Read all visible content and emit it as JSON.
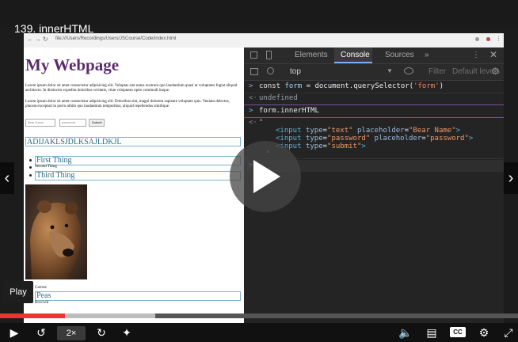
{
  "video": {
    "title": "139. innerHTML",
    "speed": "2×",
    "tooltip": "Play",
    "progress_fraction": 0.125,
    "buffered_fraction": 0.3
  },
  "browser": {
    "url": "file:///Users/Recordings/Users/JSCourse/Code/index.html"
  },
  "webpage": {
    "heading": "My Webpage",
    "paragraph1": "Lorem ipsum dolor sit amet consectetur adipisicing elit. Voluptas sint natus nostrum quo laudantium quasi ut voluptates fugiat aliquid architecto. In distinctio expedita doloribus veritatis, vitae voluptates optio commodi itaque.",
    "paragraph2": "Lorem ipsum dolor sit amet consectetur adipisicing elit. Doloribus sint, magni dolorem sapiente voluptate quis. Veniam delectus, placeat excepturi in porro nihilo quo laudantium temporibus, aliquid repellendus similique.",
    "form": {
      "name_placeholder": "Bear Name",
      "password_placeholder": "password",
      "submit_label": "Submit"
    },
    "boxed_heading": "ADIJAKLSJDLKSAJLDKJL",
    "list_items": [
      "First Thing",
      "Second Thing",
      "Third Thing"
    ],
    "list2_items": [
      "Carrots",
      "Peas",
      "Broccoli"
    ]
  },
  "devtools": {
    "tabs": [
      "Elements",
      "Console",
      "Sources",
      "»"
    ],
    "active_tab": "Console",
    "context": "top",
    "filter_placeholder": "Filter",
    "levels": "Default levels",
    "console": {
      "line1_prompt": ">",
      "line1_a": "const ",
      "line1_b": "form",
      "line1_c": " = document.querySelector(",
      "line1_d": "'form'",
      "line1_e": ")",
      "line2_prompt": "<·",
      "line2_text": "undefined",
      "line3_prompt": ">",
      "line3_text": "form.innerHTML",
      "line4_prompt": "<·",
      "line4_quote": "\"",
      "html_lines": [
        {
          "tag_open": "<input ",
          "a1": "type",
          "v1": "\"text\"",
          "a2": " placeholder",
          "v2": "\"Bear Name\"",
          "close": ">"
        },
        {
          "tag_open": "<input ",
          "a1": "type",
          "v1": "\"password\"",
          "a2": " placeholder",
          "v2": "\"password\"",
          "close": ">"
        },
        {
          "tag_open": "<input ",
          "a1": "type",
          "v1": "\"submit\"",
          "a2": "",
          "v2": "",
          "close": ">"
        }
      ],
      "end_quote": "\"",
      "input_prompt": ">"
    }
  },
  "icons": {
    "play": "play-icon",
    "back": "chevron-left-icon",
    "forward": "chevron-right-icon"
  }
}
